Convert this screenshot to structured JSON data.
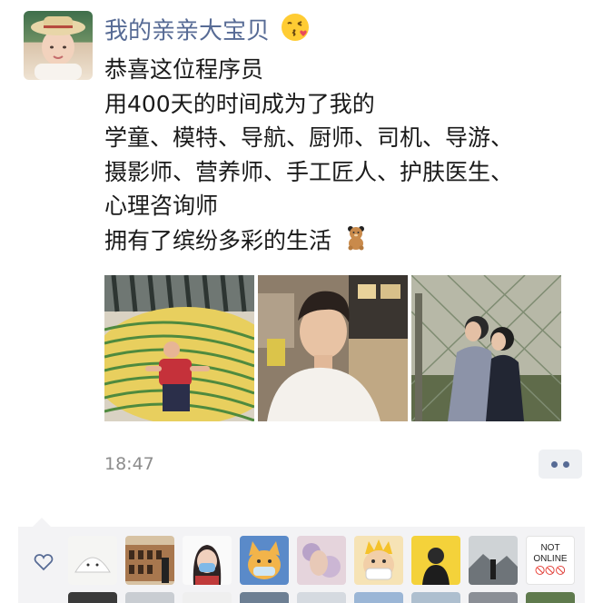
{
  "post": {
    "author": "我的亲亲大宝贝",
    "author_emoji": "kissing-face-icon",
    "lines": [
      "恭喜这位程序员",
      "用400天的时间成为了我的",
      "学童、模特、导航、厨师、司机、导游、",
      "摄影师、营养师、手工匠人、护肤医生、",
      "心理咨询师",
      "拥有了缤纷多彩的生活"
    ],
    "last_line_emoji": "teddy-bear-icon",
    "photos": [
      "photo-child-on-sculpture",
      "photo-young-man-in-mall",
      "photo-couple-at-fence"
    ],
    "time": "18:47"
  },
  "likes": {
    "icon": "heart-outline-icon",
    "not_online_line1": "NOT",
    "not_online_line2": "ONLINE",
    "not_online_symbols": "🚫🚫🚫"
  },
  "colors": {
    "author_link": "#576b95",
    "time_gray": "#8c8c8c",
    "likes_bg": "#f3f3f5"
  }
}
